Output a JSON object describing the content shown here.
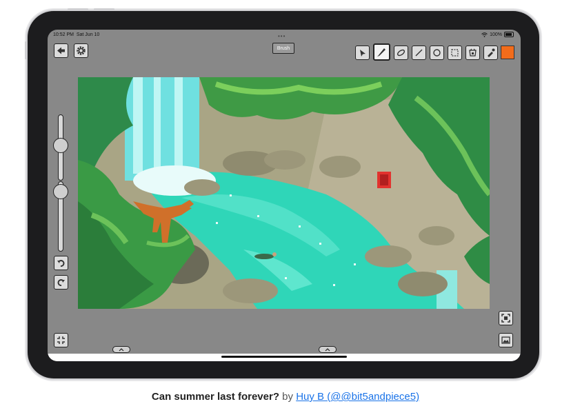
{
  "status_bar": {
    "time": "10:52 PM",
    "date": "Sat Jun 10",
    "battery": "100%"
  },
  "toolbar": {
    "mode_label": "Brush",
    "left_tools": [
      {
        "name": "back-icon"
      },
      {
        "name": "settings-icon"
      }
    ],
    "right_tools": [
      {
        "name": "select-arrow-icon"
      },
      {
        "name": "brush-icon",
        "active": true
      },
      {
        "name": "eraser-icon"
      },
      {
        "name": "line-icon"
      },
      {
        "name": "circle-icon"
      },
      {
        "name": "marquee-icon"
      },
      {
        "name": "fill-bucket-icon"
      },
      {
        "name": "eyedropper-icon"
      }
    ],
    "current_color": "#f26c1b"
  },
  "left_panel": {
    "undo_icon": "undo-icon",
    "redo_icon": "redo-icon",
    "size_slider_level": 0.55,
    "opacity_slider_level": 0.2
  },
  "bottom_controls": {
    "grid_icon": "grid-icon",
    "fit_icon": "fit-screen-icon",
    "image_icon": "image-icon"
  },
  "canvas": {
    "scene": "pixel-art waterfall lagoon"
  },
  "caption": {
    "title": "Can summer last forever?",
    "by": "by",
    "author": "Huy B (@@bit5andpiece5)"
  }
}
